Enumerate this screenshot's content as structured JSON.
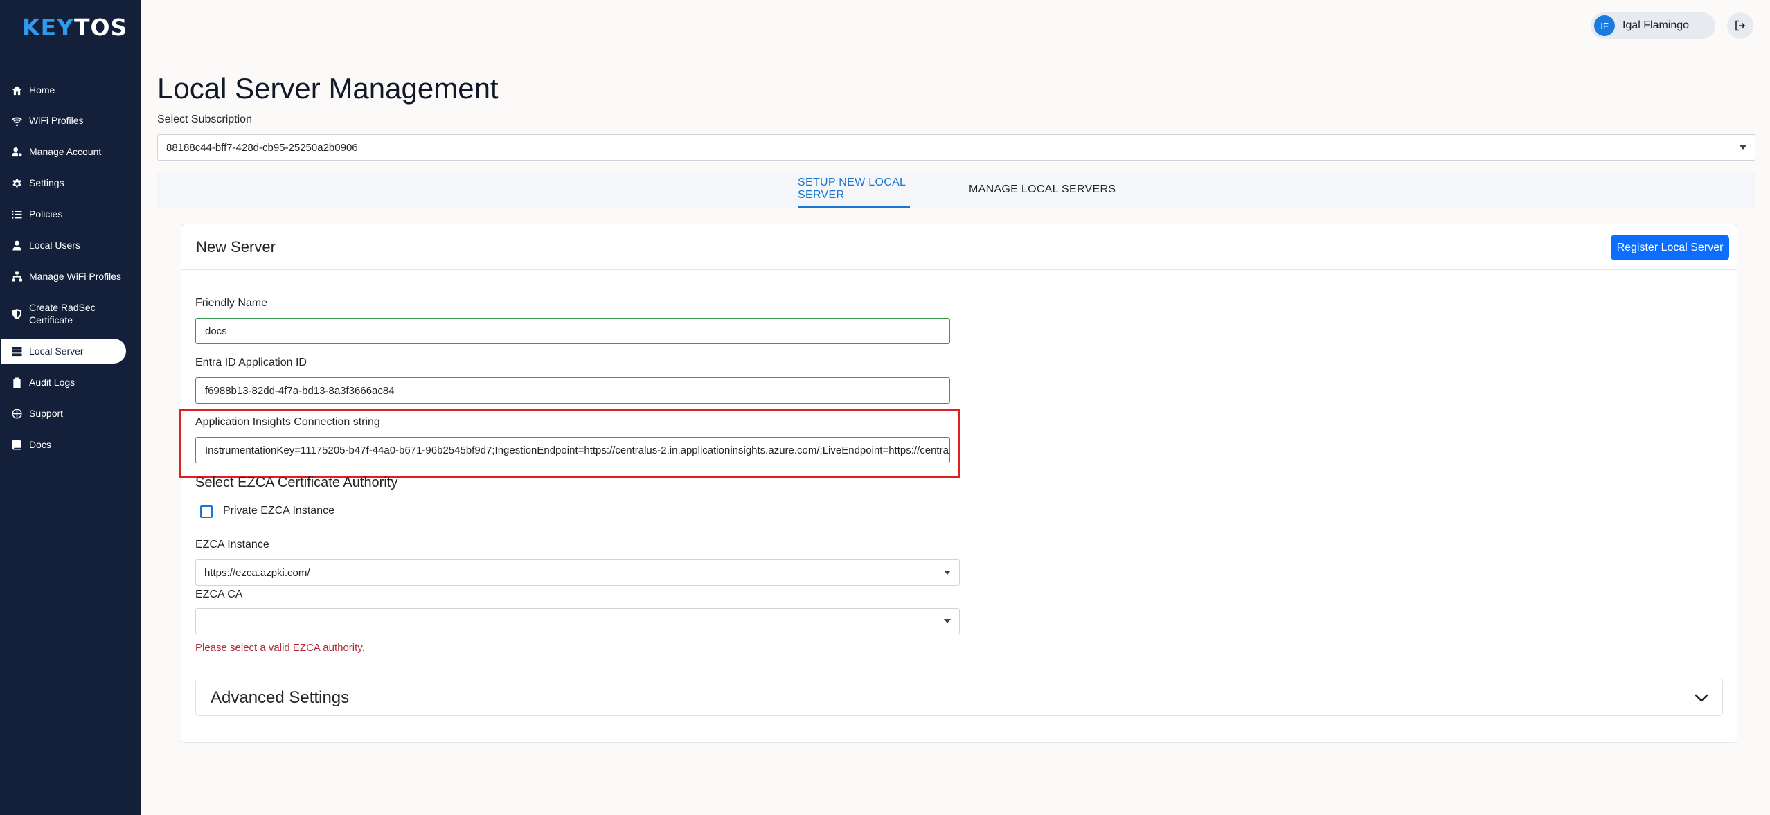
{
  "brand": {
    "logo_prefix": "KEY",
    "logo_suffix": "TOS",
    "accent": "#2e9bf0"
  },
  "sidebar": {
    "items": [
      {
        "label": "Home",
        "icon": "home-icon"
      },
      {
        "label": "WiFi Profiles",
        "icon": "wifi-icon"
      },
      {
        "label": "Manage Account",
        "icon": "user-gear-icon"
      },
      {
        "label": "Settings",
        "icon": "gear-icon"
      },
      {
        "label": "Policies",
        "icon": "list-icon"
      },
      {
        "label": "Local Users",
        "icon": "user-icon"
      },
      {
        "label": "Manage WiFi Profiles",
        "icon": "network-icon"
      },
      {
        "label": "Create RadSec Certificate",
        "icon": "shield-icon"
      },
      {
        "label": "Local Server",
        "icon": "server-icon",
        "active": true
      },
      {
        "label": "Audit Logs",
        "icon": "clipboard-icon"
      },
      {
        "label": "Support",
        "icon": "globe-icon"
      },
      {
        "label": "Docs",
        "icon": "book-icon"
      }
    ]
  },
  "topbar": {
    "user_initials": "IF",
    "user_name": "Igal Flamingo",
    "logout_icon": "logout-icon"
  },
  "main": {
    "title": "Local Server Management",
    "subscription_label": "Select Subscription",
    "subscription_value": "88188c44-bff7-428d-cb95-25250a2b0906",
    "tabs": [
      {
        "label": "SETUP NEW LOCAL SERVER",
        "active": true
      },
      {
        "label": "MANAGE LOCAL SERVERS",
        "active": false
      }
    ]
  },
  "card": {
    "title": "New Server",
    "register_button": "Register Local Server",
    "friendly_name_label": "Friendly Name",
    "friendly_name_value": "docs",
    "entra_label": "Entra ID Application ID",
    "entra_value": "f6988b13-82dd-4f7a-bd13-8a3f3666ac84",
    "insights_label": "Application Insights Connection string",
    "insights_value": "InstrumentationKey=11175205-b47f-44a0-b671-96b2545bf9d7;IngestionEndpoint=https://centralus-2.in.applicationinsights.azure.com/;LiveEndpoint=https://centralus.livediagnostics.monitor.azure.com/",
    "ezca_heading": "Select EZCA Certificate Authority",
    "private_checkbox_label": "Private EZCA Instance",
    "private_checked": false,
    "ezca_instance_label": "EZCA Instance",
    "ezca_instance_value": "https://ezca.azpki.com/",
    "ezca_ca_label": "EZCA CA",
    "ezca_ca_value": "",
    "error_message": "Please select a valid EZCA authority.",
    "advanced_title": "Advanced Settings"
  },
  "colors": {
    "sidebar_bg": "#14203a",
    "primary": "#0d6efd",
    "tab_active": "#1976d2",
    "error": "#b02a37",
    "highlight": "#e02020"
  }
}
